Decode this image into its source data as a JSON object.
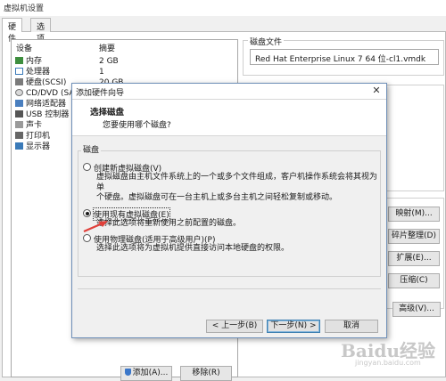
{
  "window": {
    "title": "虚拟机设置",
    "tabs": [
      "硬件",
      "选项"
    ]
  },
  "device_list": {
    "headers": {
      "device": "设备",
      "summary": "摘要"
    },
    "rows": [
      {
        "icon": "memory-icon",
        "device": "内存",
        "summary": "2 GB"
      },
      {
        "icon": "processor-icon",
        "device": "处理器",
        "summary": "1"
      },
      {
        "icon": "hard-disk-icon",
        "device": "硬盘(SCSI)",
        "summary": "20 GB"
      },
      {
        "icon": "cd-dvd-icon",
        "device": "CD/DVD (SATA)",
        "summary": ""
      },
      {
        "icon": "network-adapter-icon",
        "device": "网络适配器",
        "summary": ""
      },
      {
        "icon": "usb-controller-icon",
        "device": "USB 控制器",
        "summary": ""
      },
      {
        "icon": "sound-card-icon",
        "device": "声卡",
        "summary": ""
      },
      {
        "icon": "printer-icon",
        "device": "打印机",
        "summary": ""
      },
      {
        "icon": "display-icon",
        "device": "显示器",
        "summary": ""
      }
    ],
    "add_button": "添加(A)...",
    "remove_button": "移除(R)"
  },
  "disk_file": {
    "label": "磁盘文件",
    "value": "Red Hat Enterprise Linux 7 64 位-cl1.vmdk"
  },
  "right_buttons": {
    "map": "映射(M)...",
    "defrag": "碎片整理(D)",
    "expand": "扩展(E)...",
    "compact": "压缩(C)",
    "advanced": "高级(V)..."
  },
  "wizard": {
    "title": "添加硬件向导",
    "heading": "选择磁盘",
    "subheading": "您要使用哪个磁盘?",
    "group_label": "磁盘",
    "options": [
      {
        "label": "创建新虚拟磁盘(V)",
        "checked": false,
        "desc": [
          "虚拟磁盘由主机文件系统上的一个或多个文件组成，客户机操作系统会将其视为单",
          "个硬盘。虚拟磁盘可在一台主机上或多台主机之间轻松复制或移动。"
        ]
      },
      {
        "label": "使用现有虚拟磁盘(E)",
        "checked": true,
        "desc": [
          "选择此选项将重新使用之前配置的磁盘。"
        ]
      },
      {
        "label": "使用物理磁盘(适用于高级用户)(P)",
        "checked": false,
        "desc": [
          "选择此选项将为虚拟机提供直接访问本地硬盘的权限。"
        ]
      }
    ],
    "buttons": {
      "back": "< 上一步(B)",
      "next": "下一步(N) >",
      "cancel": "取消"
    }
  },
  "watermark": {
    "text": "Baidu经验",
    "url": "jingyan.baidu.com"
  },
  "colors": {
    "accent": "#3c7fb1",
    "arrow": "#e0403a"
  }
}
